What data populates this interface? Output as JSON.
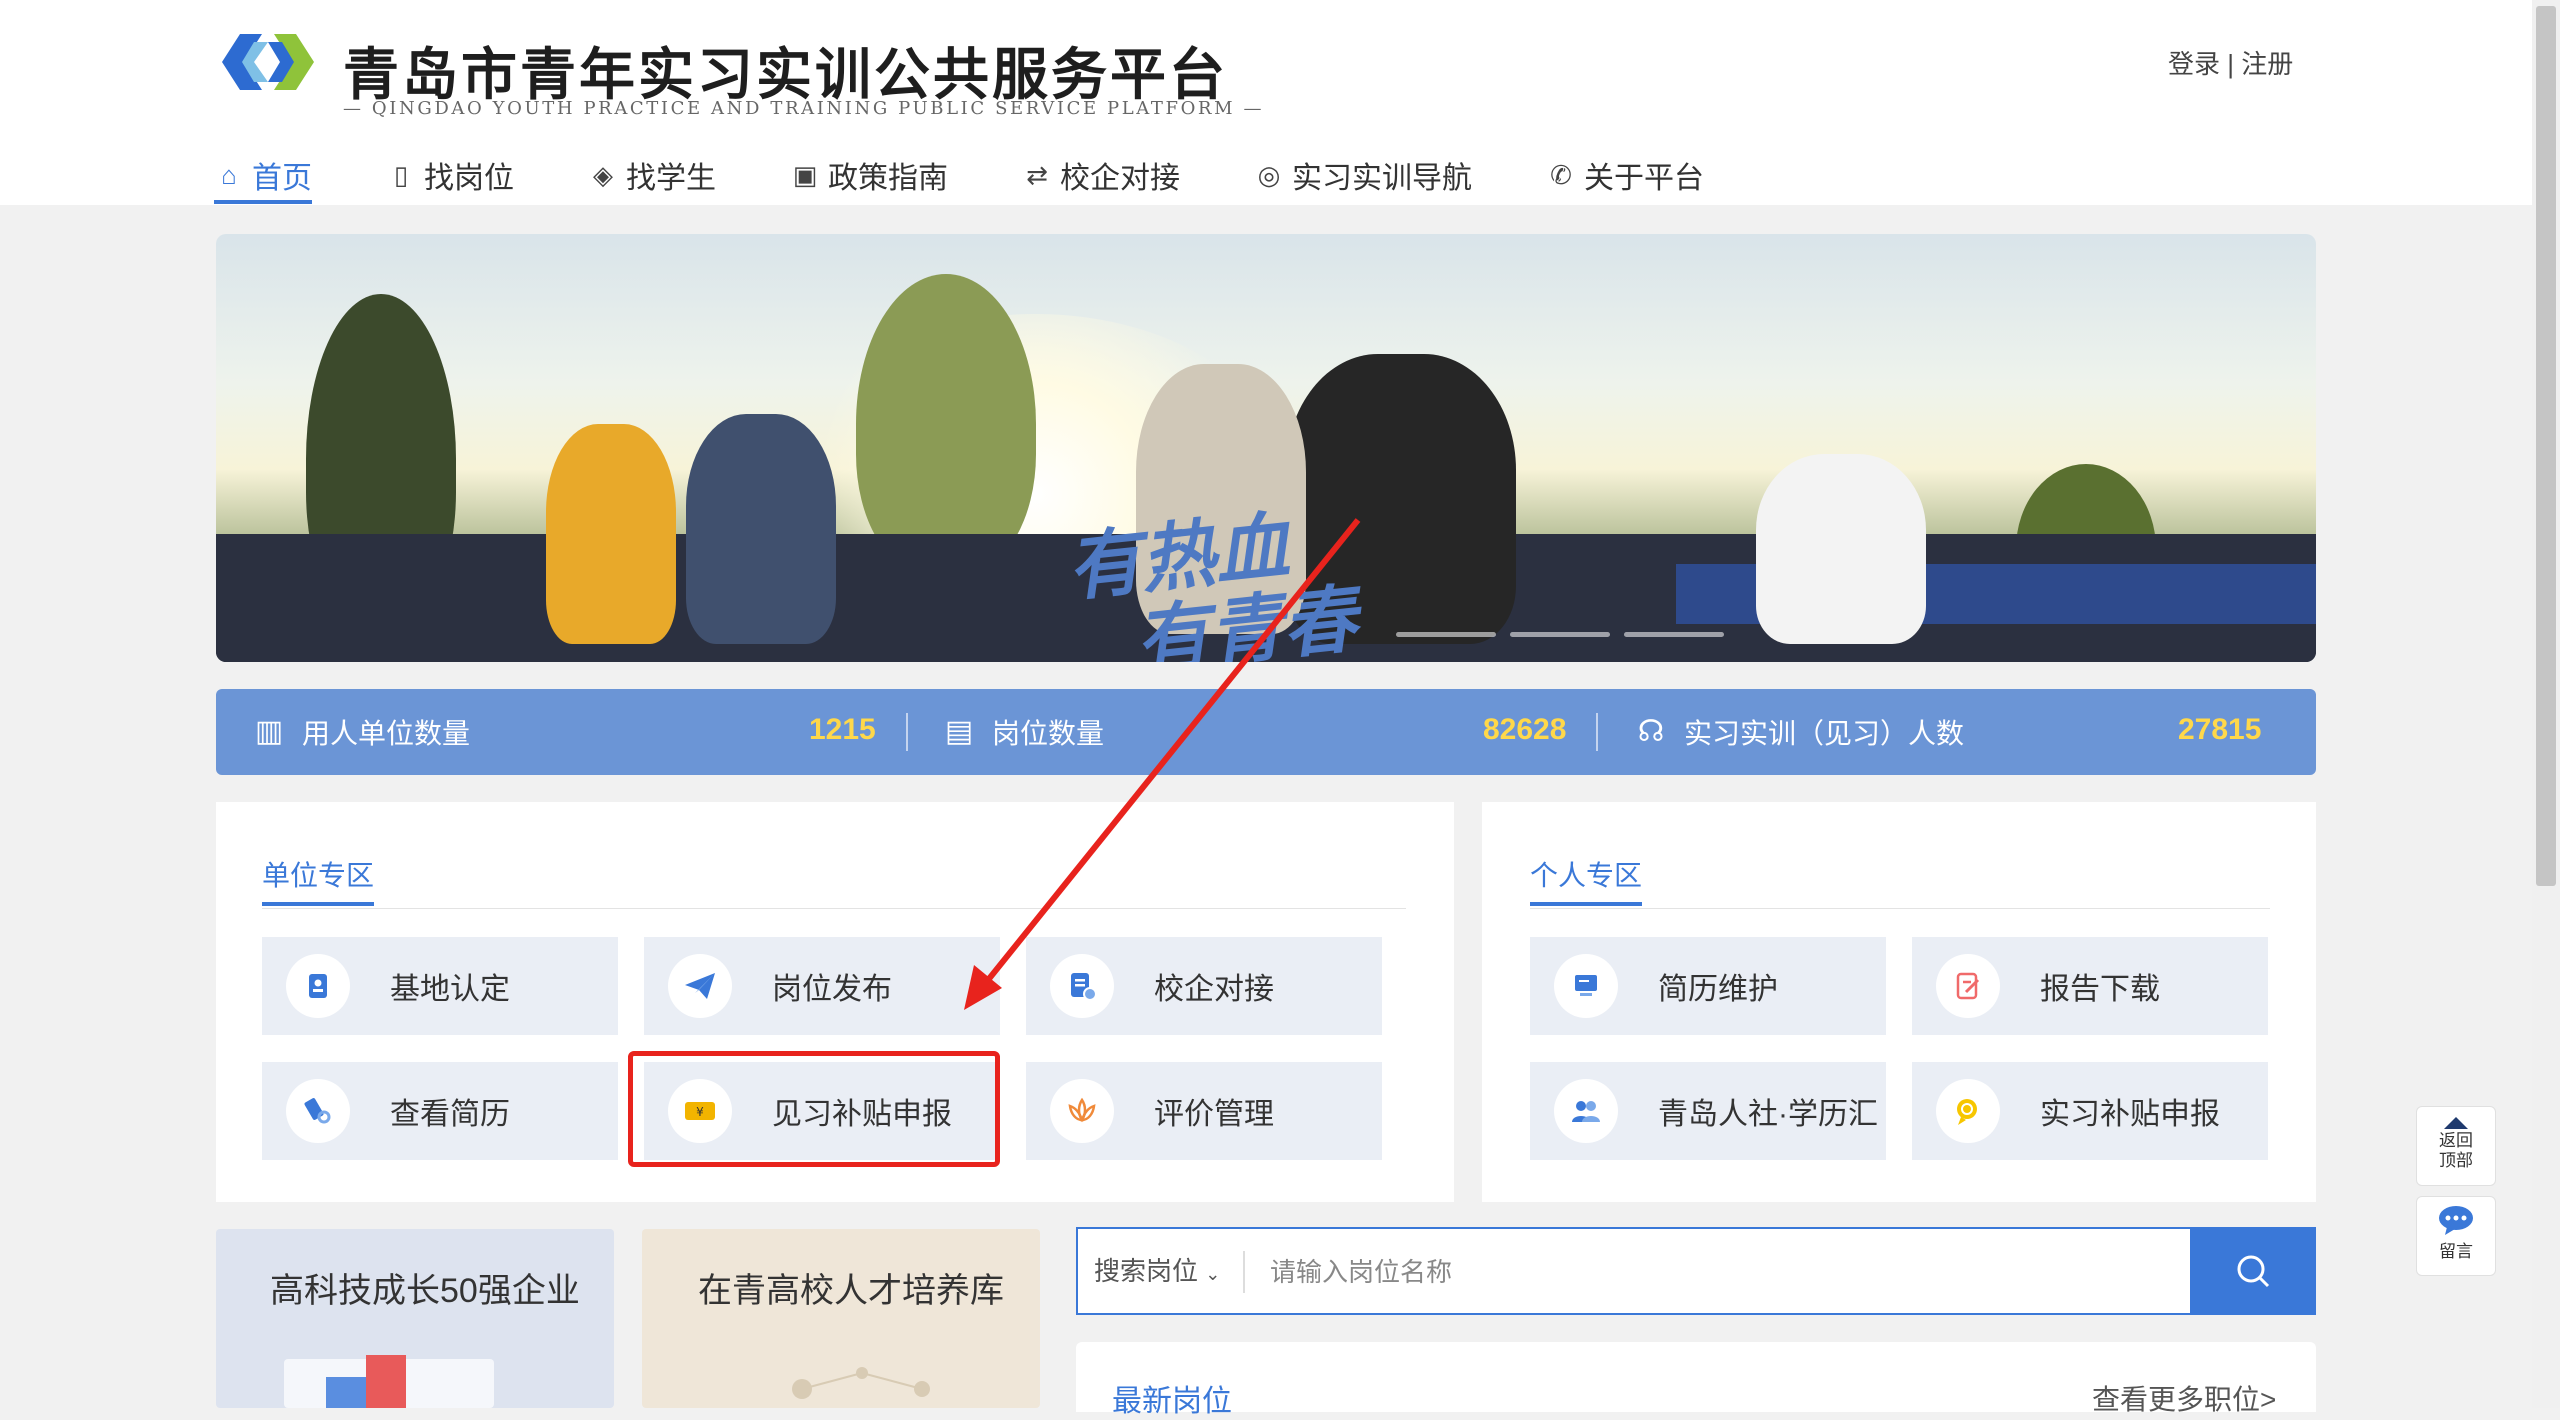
{
  "header": {
    "title": "青岛市青年实习实训公共服务平台",
    "subtitle": "— QINGDAO YOUTH PRACTICE AND TRAINING PUBLIC SERVICE PLATFORM —",
    "login": "登录",
    "separator": "|",
    "register": "注册",
    "colors": {
      "accent": "#3a78d8",
      "logo_blue": "#2d6bd1",
      "logo_green": "#8fc33a"
    }
  },
  "nav": {
    "items": [
      {
        "label": "首页",
        "icon": "home-icon",
        "active": true
      },
      {
        "label": "找岗位",
        "icon": "job-icon"
      },
      {
        "label": "找学生",
        "icon": "graduation-cap-icon"
      },
      {
        "label": "政策指南",
        "icon": "policy-icon"
      },
      {
        "label": "校企对接",
        "icon": "handshake-icon"
      },
      {
        "label": "实习实训导航",
        "icon": "compass-icon"
      },
      {
        "label": "关于平台",
        "icon": "phone-icon"
      }
    ]
  },
  "banner": {
    "slogan_line1": "有热血",
    "slogan_line2": "有青春"
  },
  "stats": [
    {
      "label": "用人单位数量",
      "value": "1215",
      "icon": "building-icon"
    },
    {
      "label": "岗位数量",
      "value": "82628",
      "icon": "position-icon"
    },
    {
      "label": "实习实训（见习）人数",
      "value": "27815",
      "icon": "people-icon"
    }
  ],
  "unit_zone": {
    "title": "单位专区",
    "tiles": [
      {
        "label": "基地认定",
        "icon": "id-card-icon"
      },
      {
        "label": "岗位发布",
        "icon": "paper-plane-icon"
      },
      {
        "label": "校企对接",
        "icon": "document-clock-icon"
      },
      {
        "label": "查看简历",
        "icon": "resume-icon"
      },
      {
        "label": "见习补贴申报",
        "icon": "yen-ticket-icon"
      },
      {
        "label": "评价管理",
        "icon": "lotus-icon"
      }
    ]
  },
  "personal_zone": {
    "title": "个人专区",
    "tiles": [
      {
        "label": "简历维护",
        "icon": "computer-icon"
      },
      {
        "label": "报告下载",
        "icon": "edit-document-icon"
      },
      {
        "label": "青岛人社·学历汇",
        "icon": "users-icon"
      },
      {
        "label": "实习补贴申报",
        "icon": "badge-icon"
      }
    ]
  },
  "cards": [
    {
      "title": "高科技成长50强企业"
    },
    {
      "title": "在青高校人才培养库"
    }
  ],
  "search": {
    "type_label": "搜索岗位",
    "placeholder": "请输入岗位名称"
  },
  "latest": {
    "title": "最新岗位",
    "more": "查看更多职位>"
  },
  "float": {
    "top_line1": "返回",
    "top_line2": "顶部",
    "message": "留言"
  }
}
